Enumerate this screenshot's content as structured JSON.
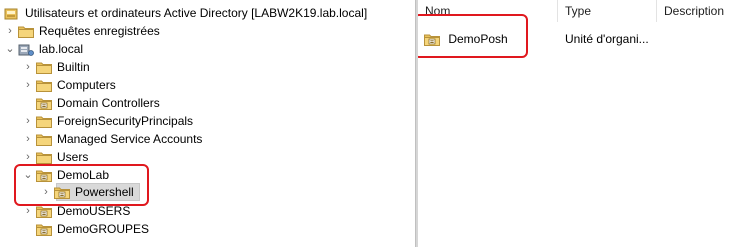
{
  "tree": {
    "root_label": "Utilisateurs et ordinateurs Active Directory [LABW2K19.lab.local]",
    "saved_queries_label": "Requêtes enregistrées",
    "domain_label": "lab.local",
    "children": [
      "Builtin",
      "Computers",
      "Domain Controllers",
      "ForeignSecurityPrincipals",
      "Managed Service Accounts",
      "Users"
    ],
    "demolab_label": "DemoLab",
    "powershell_label": "Powershell",
    "demousers_label": "DemoUSERS",
    "demogroupes_label": "DemoGROUPES"
  },
  "list": {
    "columns": [
      "Nom",
      "Type",
      "Description"
    ],
    "rows": [
      {
        "name": "DemoPosh",
        "type": "Unité d'organi...",
        "description": ""
      }
    ]
  },
  "colors": {
    "highlight_border": "#e0181e",
    "selection_bg": "#d9d9d9",
    "folder_yellow": "#e9c15b"
  },
  "icons": {
    "root": "ad-console-icon",
    "saved_queries": "folder-icon",
    "domain": "domain-icon",
    "folder": "folder-icon",
    "ou": "ou-folder-icon"
  }
}
